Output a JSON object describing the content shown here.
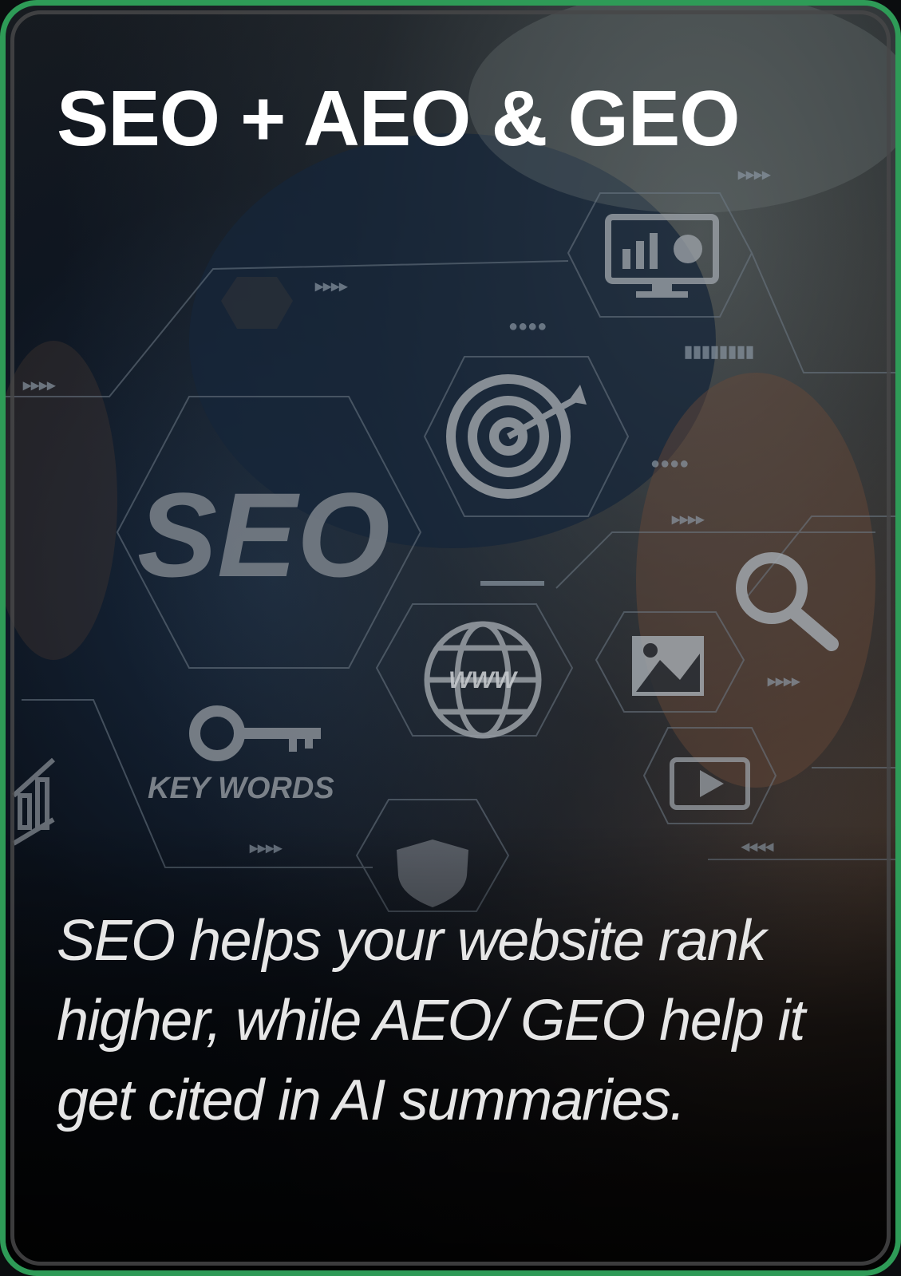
{
  "card": {
    "title": "SEO + AEO & GEO",
    "description": "SEO helps your website rank higher, while AEO/ GEO help it get cited in AI summaries.",
    "border_color": "#2e9b57"
  },
  "background_image": {
    "labels": {
      "seo": "SEO",
      "keywords": "KEY WORDS",
      "www": "WWW"
    },
    "icons": [
      "analytics-monitor-icon",
      "target-icon",
      "magnifier-icon",
      "globe-icon",
      "image-icon",
      "key-icon",
      "video-play-icon",
      "shield-icon",
      "bar-chart-icon"
    ]
  }
}
